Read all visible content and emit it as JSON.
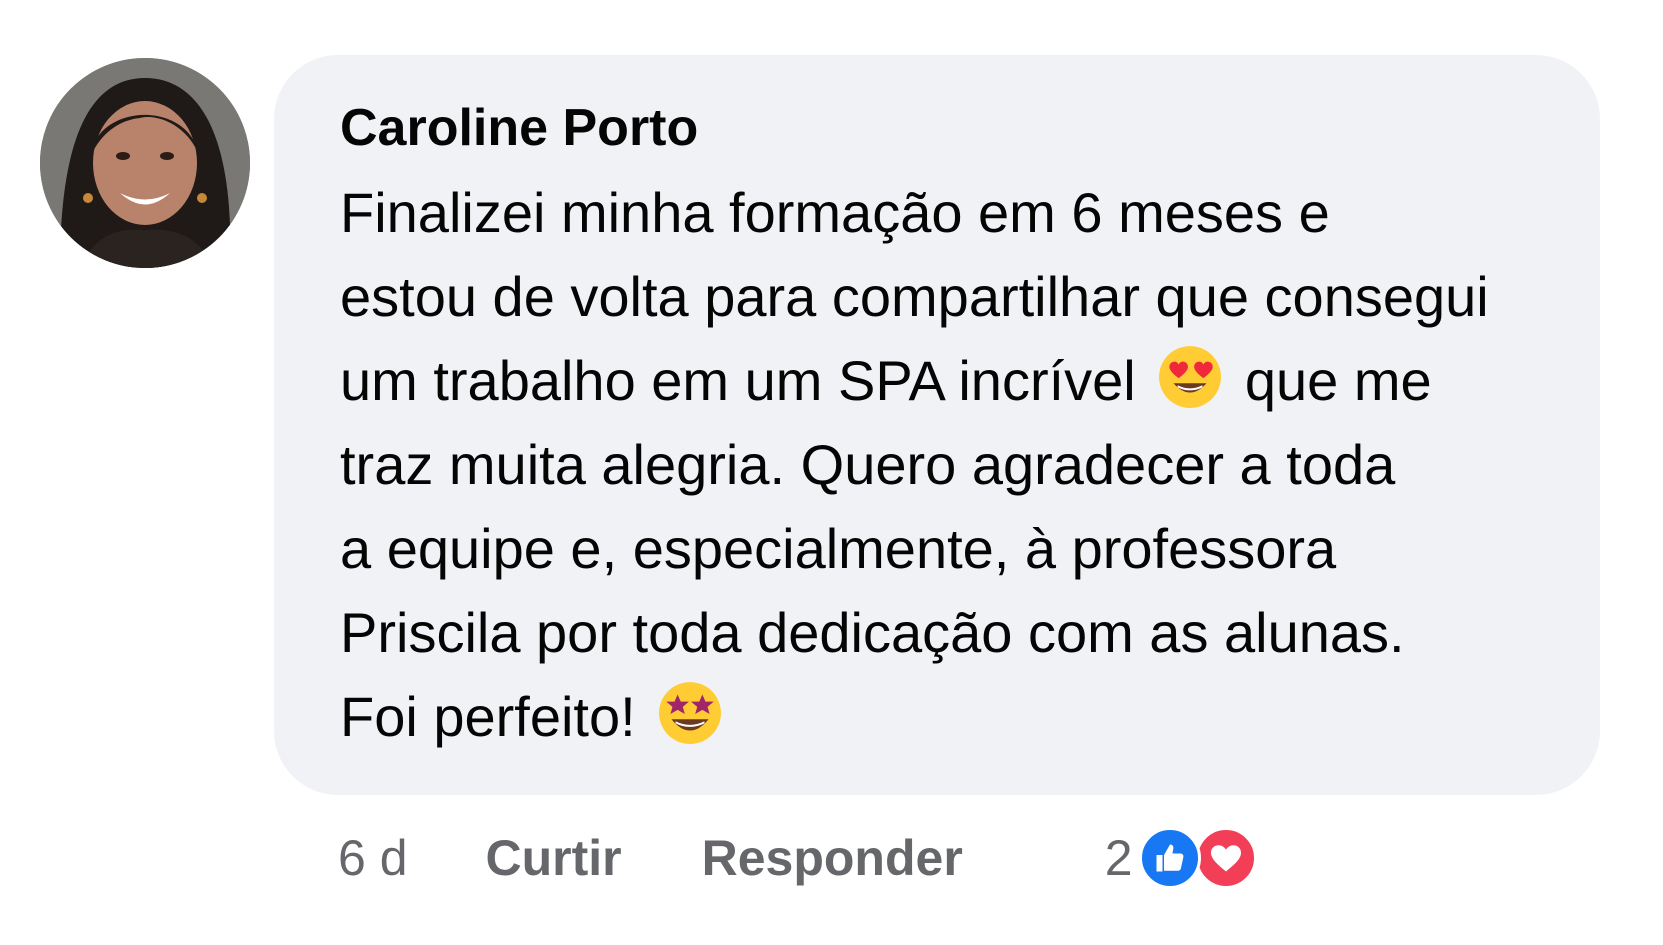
{
  "comment": {
    "author": "Caroline Porto",
    "avatar_icon": "profile-photo",
    "text_lines": [
      "Finalizei minha formação em 6 meses e",
      "estou de volta para compartilhar que consegui",
      "um trabalho em um SPA incrível",
      "que me",
      "traz muita alegria. Quero agradecer a toda",
      "a equipe e, especialmente, à professora",
      "Priscila por toda dedicação com as alunas.",
      "Foi perfeito!"
    ],
    "emojis": {
      "heart_eyes": "smiling-face-with-heart-eyes-icon",
      "star_struck": "star-struck-icon"
    }
  },
  "actions": {
    "time": "6 d",
    "like_label": "Curtir",
    "reply_label": "Responder",
    "reaction_count": "2",
    "reaction_icons": [
      "like-icon",
      "love-icon"
    ]
  },
  "colors": {
    "bubble_bg": "#f0f2f5",
    "text": "#050505",
    "meta": "#65676b",
    "like_blue": "#1877f2",
    "love_red": "#f33e58"
  }
}
